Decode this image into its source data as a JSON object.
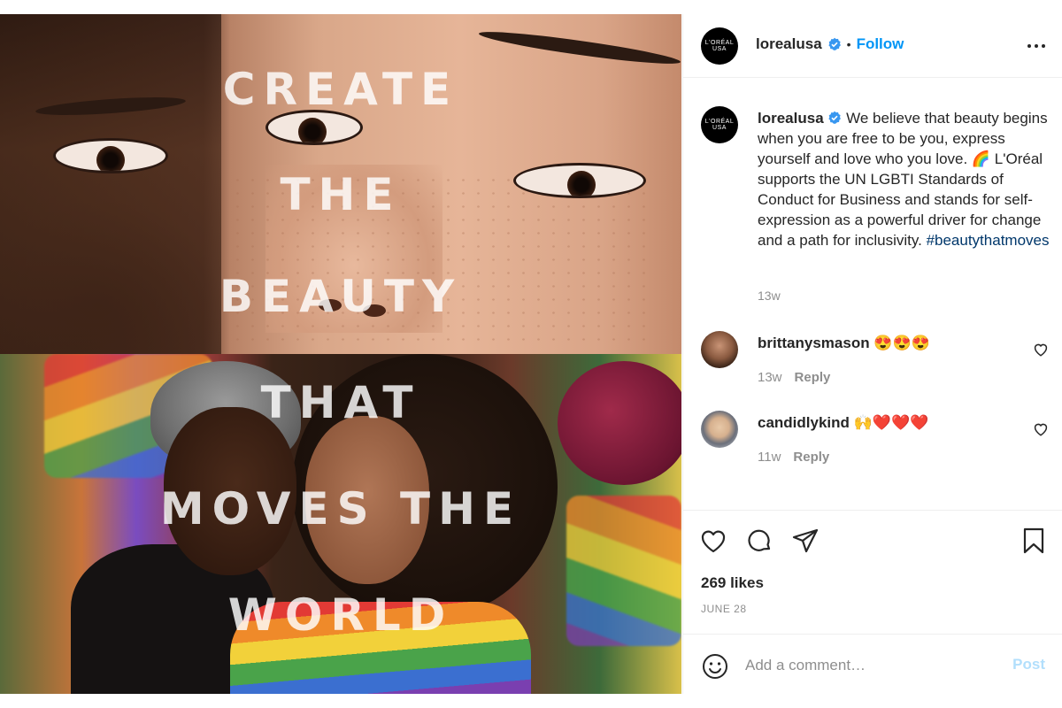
{
  "post_image": {
    "overlay_lines": [
      "CREATE",
      "THE",
      "BEAUTY",
      "THAT",
      "MOVES THE",
      "WORLD"
    ]
  },
  "header": {
    "avatar_text": "L'ORÉAL\nUSA",
    "username": "lorealusa",
    "separator": "•",
    "follow_label": "Follow",
    "more_icon": "more-horizontal-icon"
  },
  "caption": {
    "username": "lorealusa",
    "text": " We believe that beauty begins when you are free to be you, express yourself and love who you love. 🌈 L'Oréal supports the UN LGBTI Standards of Conduct for Business and stands for self-expression as a powerful driver for change and a path for inclusivity. ",
    "hashtag": "#beautythatmoves",
    "time": "13w"
  },
  "comments": [
    {
      "username": "brittanysmason",
      "text": " 😍😍😍",
      "time": "13w",
      "reply_label": "Reply"
    },
    {
      "username": "candidlykind",
      "text": " 🙌❤️❤️❤️",
      "time": "11w",
      "reply_label": "Reply"
    }
  ],
  "actions": {
    "icons": [
      "heart-icon",
      "comment-icon",
      "share-icon",
      "bookmark-icon"
    ],
    "likes": "269 likes",
    "date": "JUNE 28"
  },
  "add_comment": {
    "placeholder": "Add a comment…",
    "post_label": "Post"
  },
  "colors": {
    "accent": "#0095f6",
    "hashtag": "#00376b",
    "muted": "#8e8e8e",
    "post_disabled": "#b2dffc"
  }
}
